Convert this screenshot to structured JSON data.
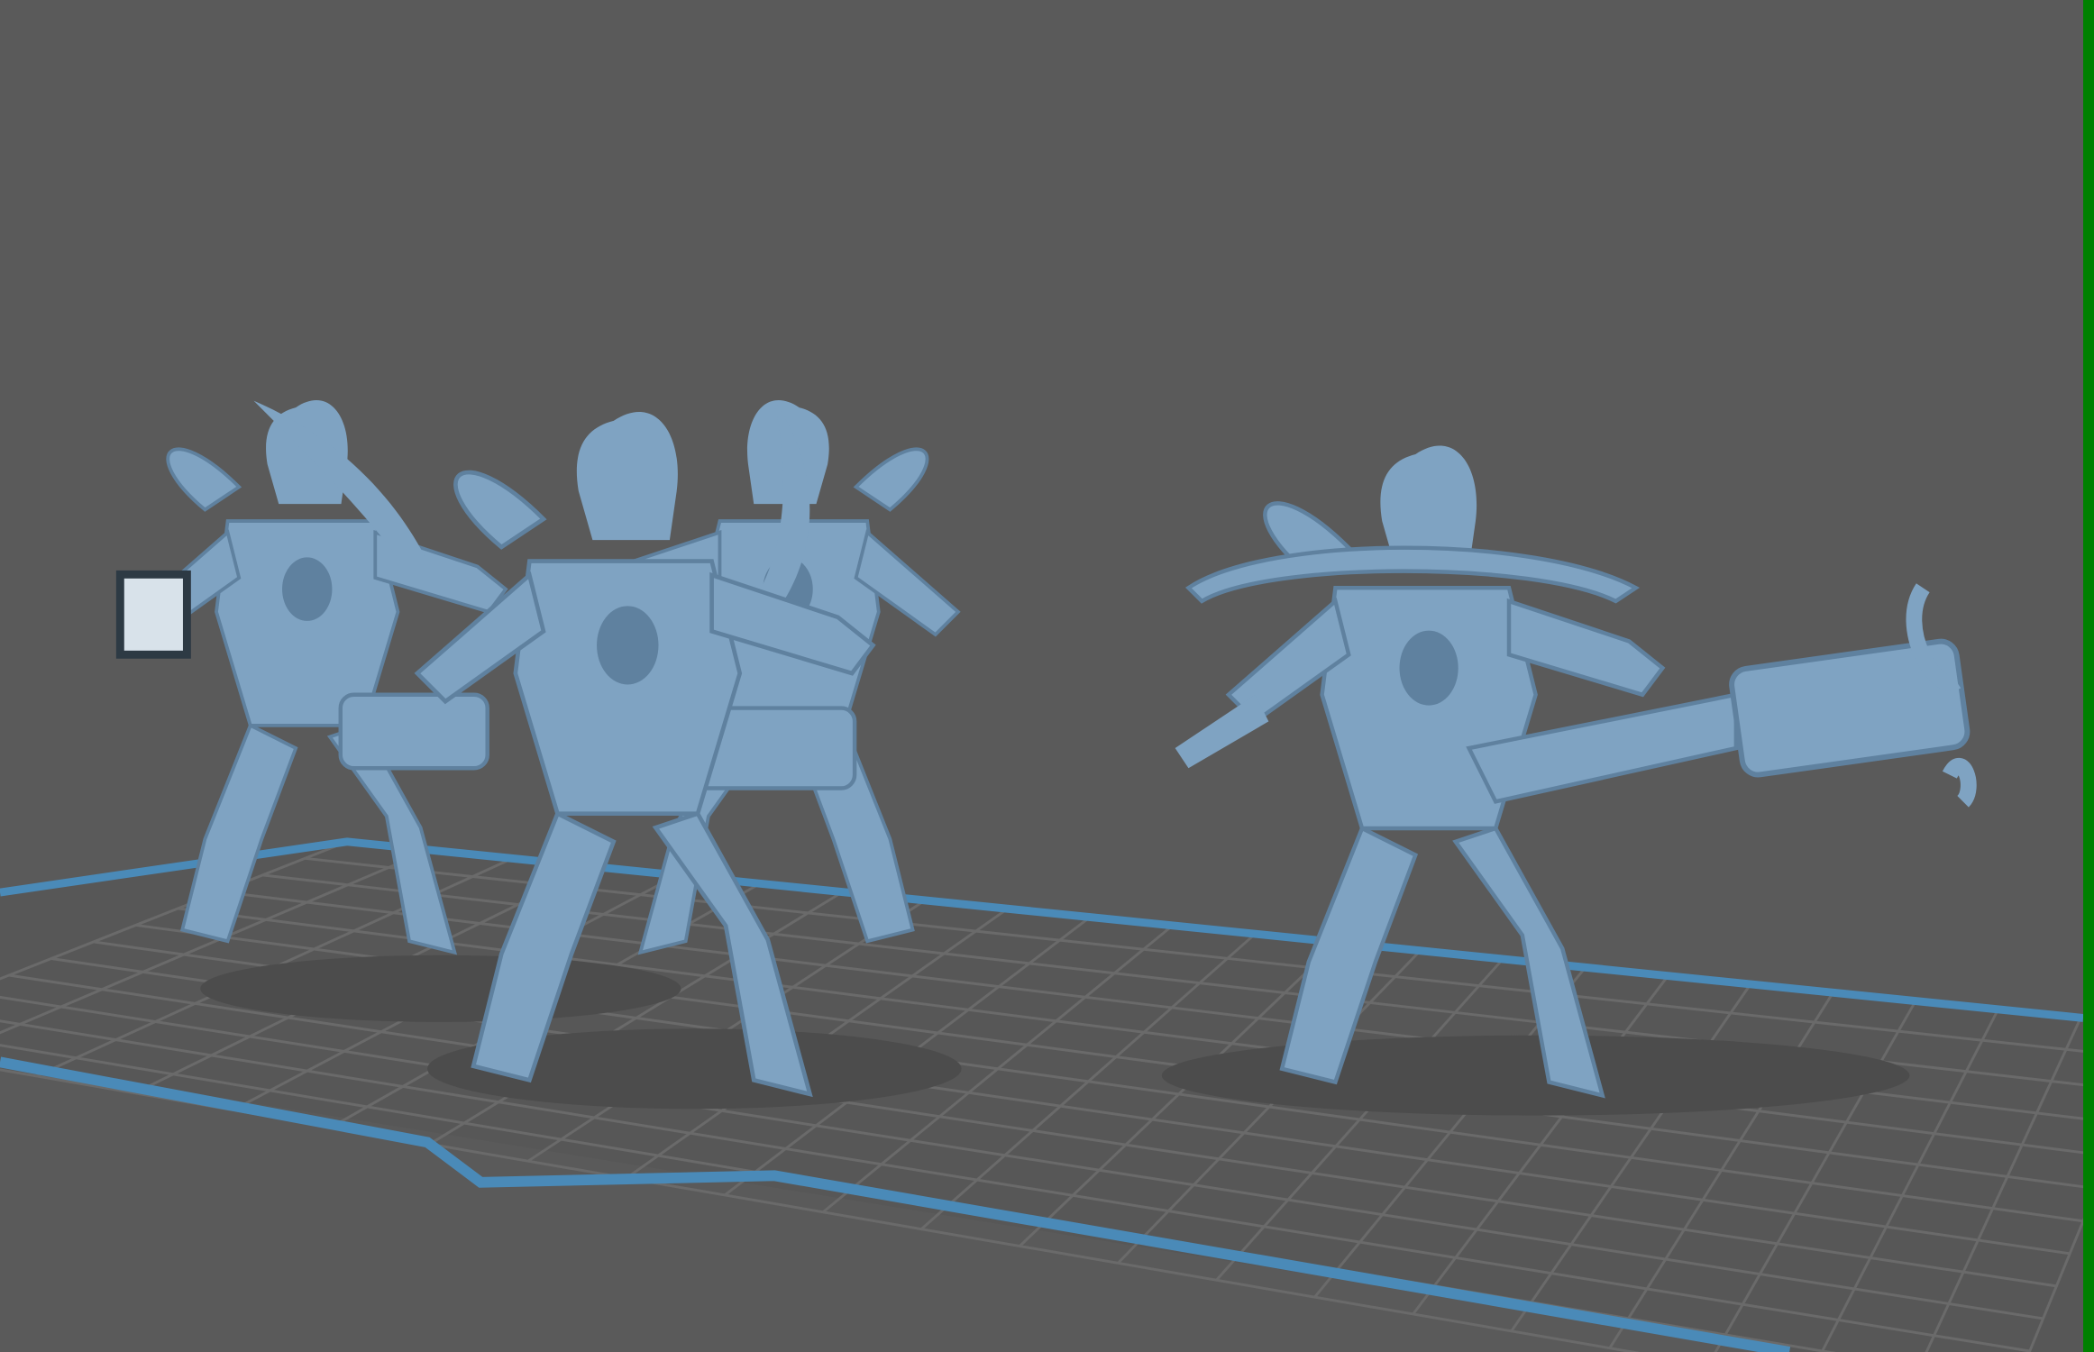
{
  "viewport": {
    "background_color": "#5a5a5a",
    "active_border_color": "#008000"
  },
  "build_plate": {
    "grid_color": "#6a6a6a",
    "edge_color": "#4a8ab8",
    "surface_color": "#575757"
  },
  "models": {
    "color": "#7fa3c2",
    "shade_color": "#5f819f",
    "count": 3,
    "items": [
      {
        "name": "miniature-left-group-back"
      },
      {
        "name": "miniature-left-group-front"
      },
      {
        "name": "miniature-right-cannon"
      }
    ]
  }
}
